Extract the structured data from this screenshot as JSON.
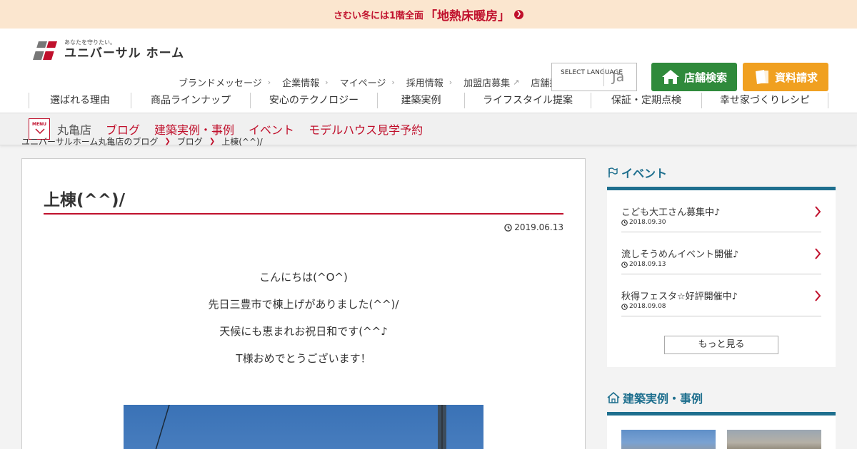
{
  "banner": {
    "small_text": "さむい冬には1階全面",
    "highlight_text": "「地熱床暖房」"
  },
  "header": {
    "logo_tagline": "あなたを守りたい。",
    "logo_name": "ユニバーサル ホーム",
    "util_nav": [
      {
        "label": "ブランドメッセージ"
      },
      {
        "label": "企業情報"
      },
      {
        "label": "マイページ"
      },
      {
        "label": "採用情報"
      },
      {
        "label": "加盟店募集"
      },
      {
        "label": "店舗採用情報"
      }
    ],
    "lang_select": {
      "label": "SELECT LANGUAGE",
      "value": "Ja"
    },
    "store_search_label": "店舗検索",
    "request_docs_label": "資料請求"
  },
  "main_nav": [
    {
      "label": "選ばれる理由"
    },
    {
      "label": "商品ラインナップ"
    },
    {
      "label": "安心のテクノロジー"
    },
    {
      "label": "建築実例"
    },
    {
      "label": "ライフスタイル提案"
    },
    {
      "label": "保証・定期点検"
    },
    {
      "label": "幸せ家づくりレシピ"
    }
  ],
  "sub_nav": {
    "menu_label": "MENU",
    "store_name": "丸亀店",
    "links": [
      {
        "label": "ブログ"
      },
      {
        "label": "建築実例・事例"
      },
      {
        "label": "イベント"
      },
      {
        "label": "モデルハウス見学予約"
      }
    ]
  },
  "breadcrumb": [
    {
      "label": "ユニバーサルホーム丸亀店のブログ"
    },
    {
      "label": "ブログ"
    },
    {
      "label": "上棟(^^)/"
    }
  ],
  "article": {
    "title": "上棟(^^)/",
    "date": "2019.06.13",
    "paragraphs": [
      "こんにちは(^O^)",
      "先日三豊市で棟上げがありました(^^)/",
      "天候にも恵まれお祝日和です(^^♪",
      "T様おめでとうございます！"
    ]
  },
  "sidebar": {
    "events_heading": "イベント",
    "events": [
      {
        "title": "こども大工さん募集中♪",
        "date": "2018.09.30"
      },
      {
        "title": "流しそうめんイベント開催♪",
        "date": "2018.09.13"
      },
      {
        "title": "秋得フェスタ☆好評開催中♪",
        "date": "2018.09.08"
      }
    ],
    "more_label": "もっと見る",
    "cases_heading": "建築実例・事例"
  },
  "colors": {
    "brand_red": "#c0102c",
    "store_green": "#2f8a3b",
    "doc_orange": "#f0a020",
    "sidebar_teal": "#1e6f8e",
    "banner_bg": "#fbe6cf"
  },
  "icons": [
    "arrow-circle-icon",
    "house-icon",
    "document-icon",
    "flag-icon",
    "home-outline-icon",
    "clock-icon",
    "chevron-right-icon",
    "external-link-icon",
    "menu-chevron-icon"
  ]
}
